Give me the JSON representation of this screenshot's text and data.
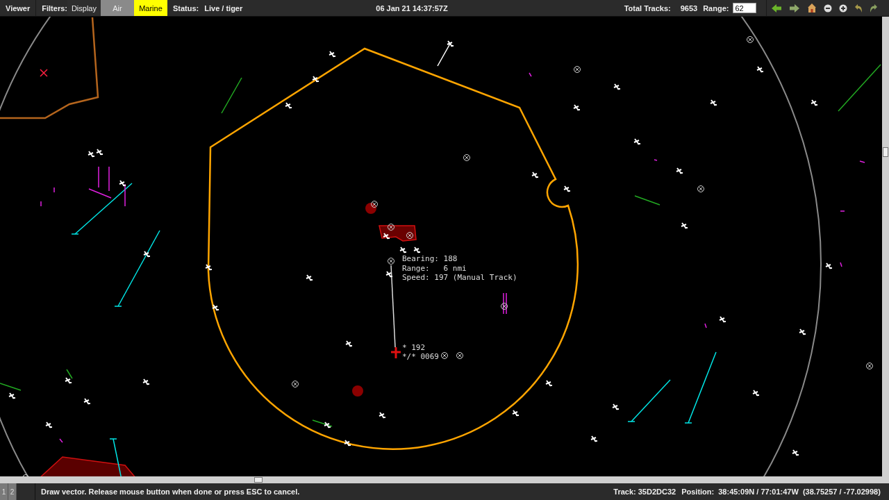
{
  "toolbar": {
    "menu": "Viewer",
    "filters_label": "Filters:",
    "filters": [
      {
        "label": "Display",
        "color": "#2e2e2e"
      },
      {
        "label": "Air",
        "color": "#8a8a8a"
      },
      {
        "label": "Marine",
        "color": "#ffff00"
      }
    ],
    "status_label": "Status:",
    "status": "Live / tiger",
    "datetime": "06 Jan 21 14:37:57Z",
    "tracks_label": "Total Tracks:",
    "tracks": "9653",
    "range_label": "Range:",
    "range_value": "62"
  },
  "map": {
    "readout": [
      "Bearing: 188",
      "Range:   6 nmi",
      "Speed: 197 (Manual Track)"
    ],
    "vector_labels": [
      "* 192",
      "*/* 0069"
    ]
  },
  "status_bar": {
    "pages": [
      "1",
      "2"
    ],
    "message": "Draw vector. Release mouse button when done or press ESC to cancel.",
    "track": "Track: 35D2DC32",
    "position_label": "Position:",
    "position": "38:45:09N / 77:01:47W  (38.75257 / -77.02998)"
  }
}
